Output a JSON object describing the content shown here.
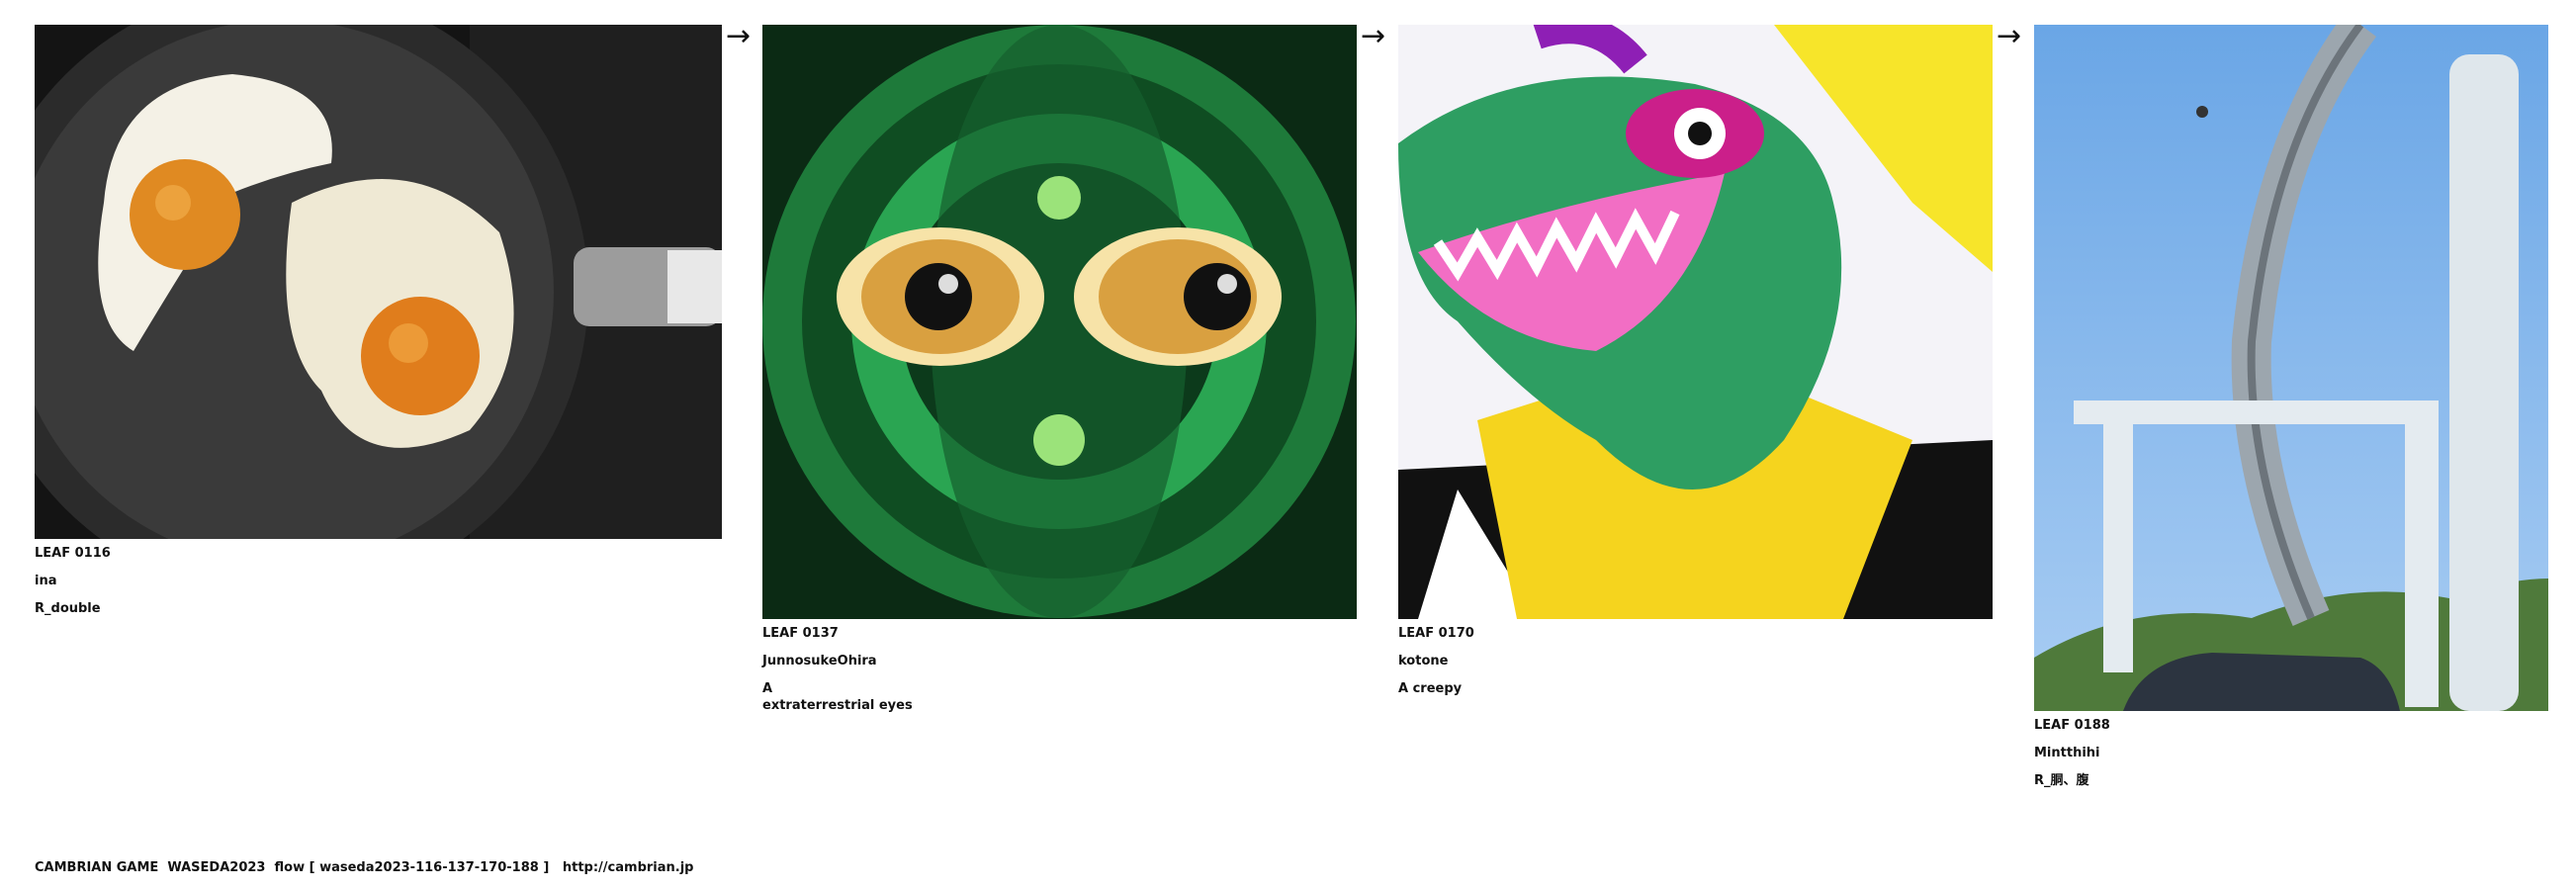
{
  "leaves": [
    {
      "id": "LEAF 0116",
      "author": "ina",
      "title": "R_double",
      "image": "fried-eggs-photo"
    },
    {
      "id": "LEAF 0137",
      "author": "JunnosukeOhira",
      "title": "A\nextraterrestrial eyes",
      "image": "green-alien-eyes-art"
    },
    {
      "id": "LEAF 0170",
      "author": "kotone",
      "title": "A creepy",
      "image": "green-dinosaur-illustration"
    },
    {
      "id": "LEAF 0188",
      "author": "Mintthihi",
      "title": "R_胴、腹",
      "image": "loop-bridge-photo"
    }
  ],
  "arrows": [
    "→",
    "→",
    "→"
  ],
  "footer": {
    "text": "CAMBRIAN GAME  WASEDA2023  flow [ waseda2023-116-137-170-188 ]   ",
    "link": "http://cambrian.jp"
  }
}
